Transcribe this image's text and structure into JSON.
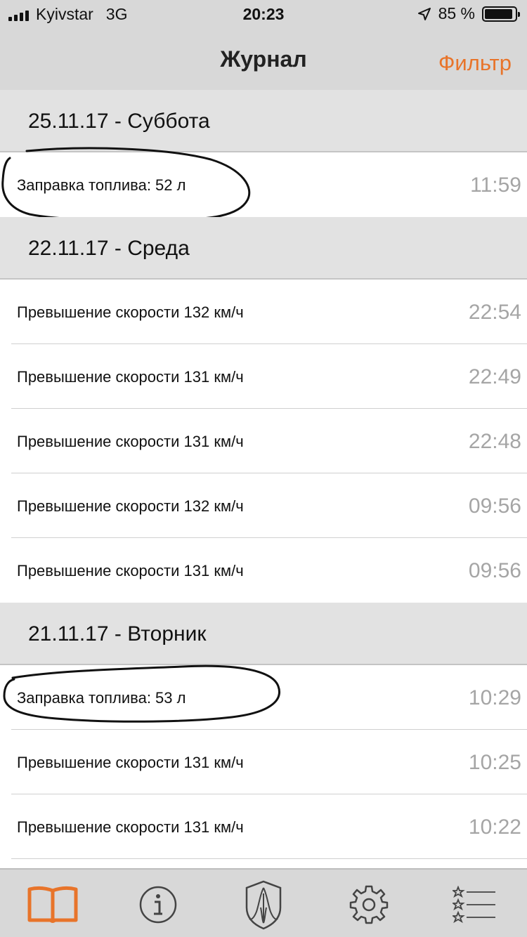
{
  "status_bar": {
    "carrier": "Kyivstar",
    "network": "3G",
    "time": "20:23",
    "battery": "85 %"
  },
  "navbar": {
    "title": "Журнал",
    "filter_label": "Фильтр"
  },
  "sections": [
    {
      "header": "25.11.17 - Суббота",
      "rows": [
        {
          "label": "Заправка топлива: 52 л",
          "time": "11:59",
          "circled": true
        }
      ]
    },
    {
      "header": "22.11.17 - Среда",
      "rows": [
        {
          "label": "Превышение скорости 132 км/ч",
          "time": "22:54"
        },
        {
          "label": "Превышение скорости 131 км/ч",
          "time": "22:49"
        },
        {
          "label": "Превышение скорости 131 км/ч",
          "time": "22:48"
        },
        {
          "label": "Превышение скорости 132 км/ч",
          "time": "09:56"
        },
        {
          "label": "Превышение скорости 131 км/ч",
          "time": "09:56"
        }
      ]
    },
    {
      "header": "21.11.17 - Вторник",
      "rows": [
        {
          "label": "Заправка топлива: 53 л",
          "time": "10:29",
          "circled": true
        },
        {
          "label": "Превышение скорости 131 км/ч",
          "time": "10:25"
        },
        {
          "label": "Превышение скорости 131 км/ч",
          "time": "10:22"
        }
      ]
    }
  ],
  "tabbar": {
    "tabs": [
      {
        "icon": "book-icon",
        "active": true
      },
      {
        "icon": "info-icon",
        "active": false
      },
      {
        "icon": "shield-emblem-icon",
        "active": false
      },
      {
        "icon": "gear-icon",
        "active": false
      },
      {
        "icon": "starred-list-icon",
        "active": false
      }
    ]
  },
  "colors": {
    "accent": "#e8742a",
    "bar_background": "#d8d8d8",
    "section_background": "#e2e2e2",
    "time_text": "#a5a5a5"
  }
}
